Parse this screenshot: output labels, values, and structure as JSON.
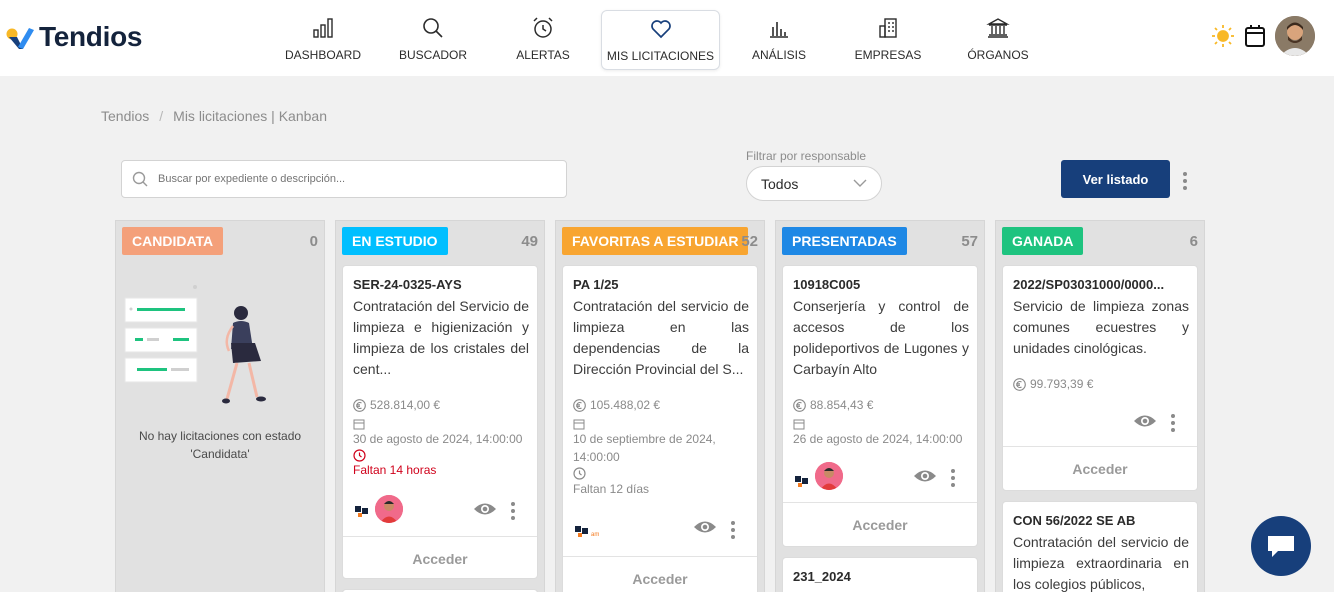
{
  "app": {
    "brand": "Tendios",
    "colors": {
      "primary": "#173f7b",
      "candidata": "#f4a07a",
      "en_estudio": "#00bfff",
      "favoritas": "#f8a531",
      "presentadas": "#1e88e5",
      "ganada": "#1ec37f"
    }
  },
  "nav": [
    {
      "label": "DASHBOARD",
      "icon": "bar-chart-icon"
    },
    {
      "label": "BUSCADOR",
      "icon": "search-icon"
    },
    {
      "label": "ALERTAS",
      "icon": "alarm-clock-icon"
    },
    {
      "label": "MIS LICITACIONES",
      "icon": "heart-icon",
      "active": true
    },
    {
      "label": "ANÁLISIS",
      "icon": "analytics-icon"
    },
    {
      "label": "EMPRESAS",
      "icon": "building-icon"
    },
    {
      "label": "ÓRGANOS",
      "icon": "institution-icon"
    }
  ],
  "header_right": {
    "theme_icon": "sun-icon",
    "calendar_icon": "calendar-icon",
    "avatar": "user-avatar"
  },
  "breadcrumb": {
    "root": "Tendios",
    "separator": "/",
    "current": "Mis licitaciones | Kanban"
  },
  "search": {
    "placeholder": "Buscar por expediente o descripción..."
  },
  "filter": {
    "label": "Filtrar por responsable",
    "selected": "Todos"
  },
  "actions": {
    "list_button": "Ver listado"
  },
  "columns": [
    {
      "title": "CANDIDATA",
      "count": "0",
      "empty_text": "No hay licitaciones con estado 'Candidata'"
    },
    {
      "title": "EN ESTUDIO",
      "count": "49",
      "cards": [
        {
          "ref": "SER-24-0325-AYS",
          "desc": "Contratación del Servicio de limpieza e higienización y limpieza de los cristales del cent...",
          "amount": "528.814,00 €",
          "date": "30 de agosto de 2024, 14:00:00",
          "deadline": "Faltan 14 horas",
          "footer": "Acceder"
        }
      ]
    },
    {
      "title": "FAVORITAS A ESTUDIAR",
      "count": "52",
      "cards": [
        {
          "ref": "PA 1/25",
          "desc": "Contratación del servicio de limpieza en las dependencias de la Dirección Provincial del S...",
          "amount": "105.488,02 €",
          "date": "10 de septiembre de 2024, 14:00:00",
          "deadline": "Faltan 12 días",
          "footer": "Acceder"
        }
      ]
    },
    {
      "title": "PRESENTADAS",
      "count": "57",
      "cards": [
        {
          "ref": "10918C005",
          "desc": "Conserjería y control de accesos de los polideportivos de Lugones y Carbayín Alto",
          "amount": "88.854,43 €",
          "date": "26 de agosto de 2024, 14:00:00",
          "footer": "Acceder"
        },
        {
          "ref": "231_2024"
        }
      ]
    },
    {
      "title": "GANADA",
      "count": "6",
      "cards": [
        {
          "ref": "2022/SP03031000/0000...",
          "desc": "Servicio de limpieza zonas comunes ecuestres y unidades cinológicas.",
          "amount": "99.793,39 €",
          "footer": "Acceder"
        },
        {
          "ref": "CON 56/2022 SE AB",
          "desc": "Contratación del servicio de limpieza extraordinaria en los colegios públicos,"
        }
      ]
    }
  ]
}
